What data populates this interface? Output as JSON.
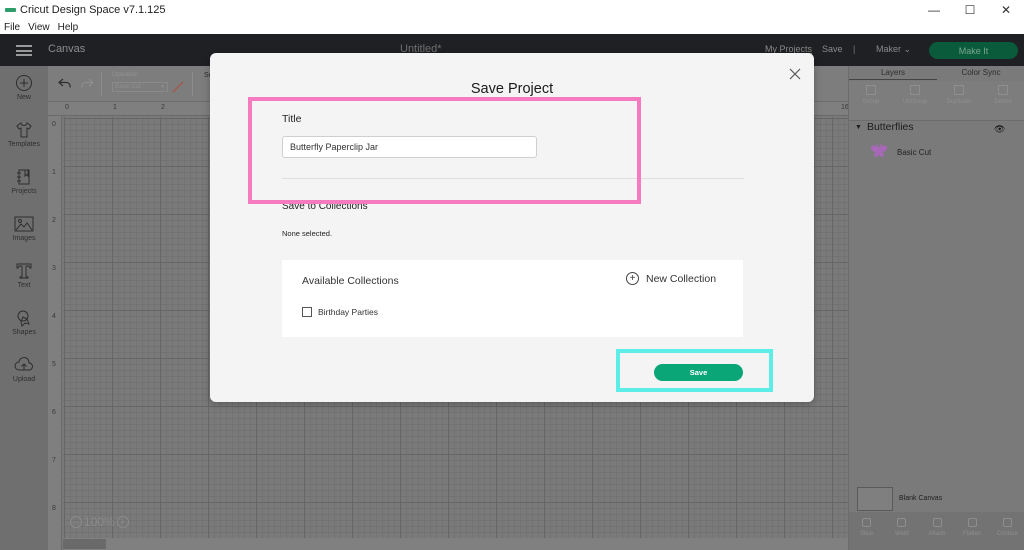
{
  "window": {
    "title": "Cricut Design Space  v7.1.125",
    "controls": [
      "minimize",
      "maximize",
      "close"
    ]
  },
  "menu": [
    "File",
    "View",
    "Help"
  ],
  "header": {
    "section": "Canvas",
    "project_title": "Untitled*",
    "my_projects": "My Projects",
    "save": "Save",
    "separator": "|",
    "machine": "Maker",
    "make_it": "Make It"
  },
  "sidebar": {
    "items": [
      {
        "label": "New",
        "icon": "plus-circle-icon"
      },
      {
        "label": "Templates",
        "icon": "tshirt-icon"
      },
      {
        "label": "Projects",
        "icon": "notebook-icon"
      },
      {
        "label": "Images",
        "icon": "image-icon"
      },
      {
        "label": "Text",
        "icon": "text-t-icon"
      },
      {
        "label": "Shapes",
        "icon": "shapes-icon"
      },
      {
        "label": "Upload",
        "icon": "cloud-upload-icon"
      }
    ]
  },
  "toolbar": {
    "operation_label": "Operation",
    "operation_value": "Basic Cut",
    "partial_label": "Se"
  },
  "rulers": {
    "top": [
      "0",
      "1",
      "2"
    ],
    "top_right": "16",
    "left": [
      "0",
      "1",
      "2",
      "3",
      "4",
      "5",
      "6",
      "7",
      "8"
    ]
  },
  "zoom": {
    "value": "100%",
    "minus": "−",
    "plus": "+"
  },
  "right_panel": {
    "tabs": [
      "Layers",
      "Color Sync"
    ],
    "active_tab": "Layers",
    "actions": [
      "Group",
      "UnGroup",
      "Duplicate",
      "Delete"
    ],
    "layer_group": "Butterflies",
    "layer_item": "Basic Cut",
    "layer_color": "#a868b8",
    "blank_canvas": "Blank Canvas",
    "tools": [
      "Slice",
      "Weld",
      "Attach",
      "Flatten",
      "Contour"
    ]
  },
  "dialog": {
    "title": "Save Project",
    "title_label": "Title",
    "title_value": "Butterfly Paperclip Jar",
    "save_to_collections": "Save to Collections",
    "none_selected": "None selected.",
    "available_collections": "Available Collections",
    "new_collection": "New Collection",
    "collections": [
      {
        "name": "Birthday Parties",
        "checked": false
      }
    ],
    "save_button": "Save"
  },
  "colors": {
    "accent_green": "#0aa678",
    "make_it_dim": "#0a5a3c",
    "highlight_pink": "#f57ac0",
    "highlight_cyan": "#5ceee6"
  }
}
